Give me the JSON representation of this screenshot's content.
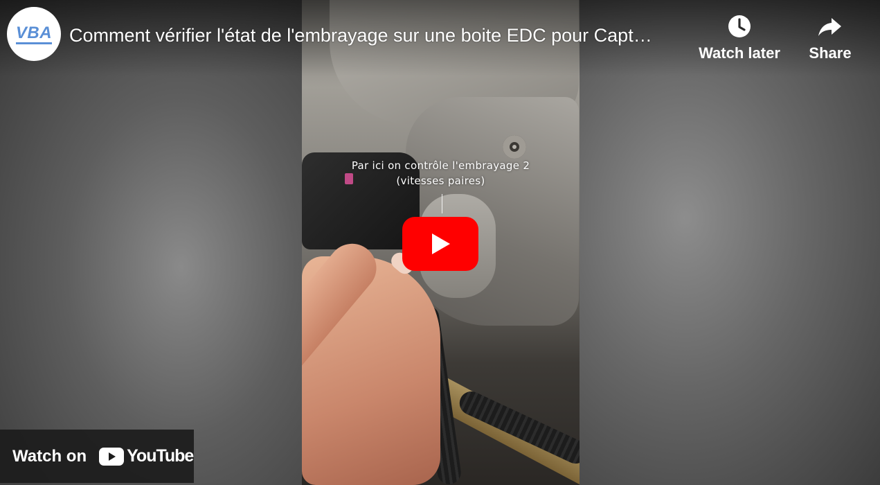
{
  "channel": {
    "avatar_text": "VBA",
    "avatar_icon": "vba-logo-icon"
  },
  "video": {
    "title": "Comment vérifier l'état de l'embrayage sur une boite EDC pour Capt…",
    "caption_line1": "Par ici on contrôle l'embrayage 2",
    "caption_line2": "(vitesses paires)"
  },
  "actions": {
    "watch_later_label": "Watch later",
    "watch_later_icon": "clock-icon",
    "share_label": "Share",
    "share_icon": "share-arrow-icon"
  },
  "play_button": {
    "icon": "play-icon",
    "color": "#ff0000"
  },
  "watch_on": {
    "label": "Watch on",
    "brand": "YouTube",
    "brand_icon": "youtube-logo-icon"
  }
}
